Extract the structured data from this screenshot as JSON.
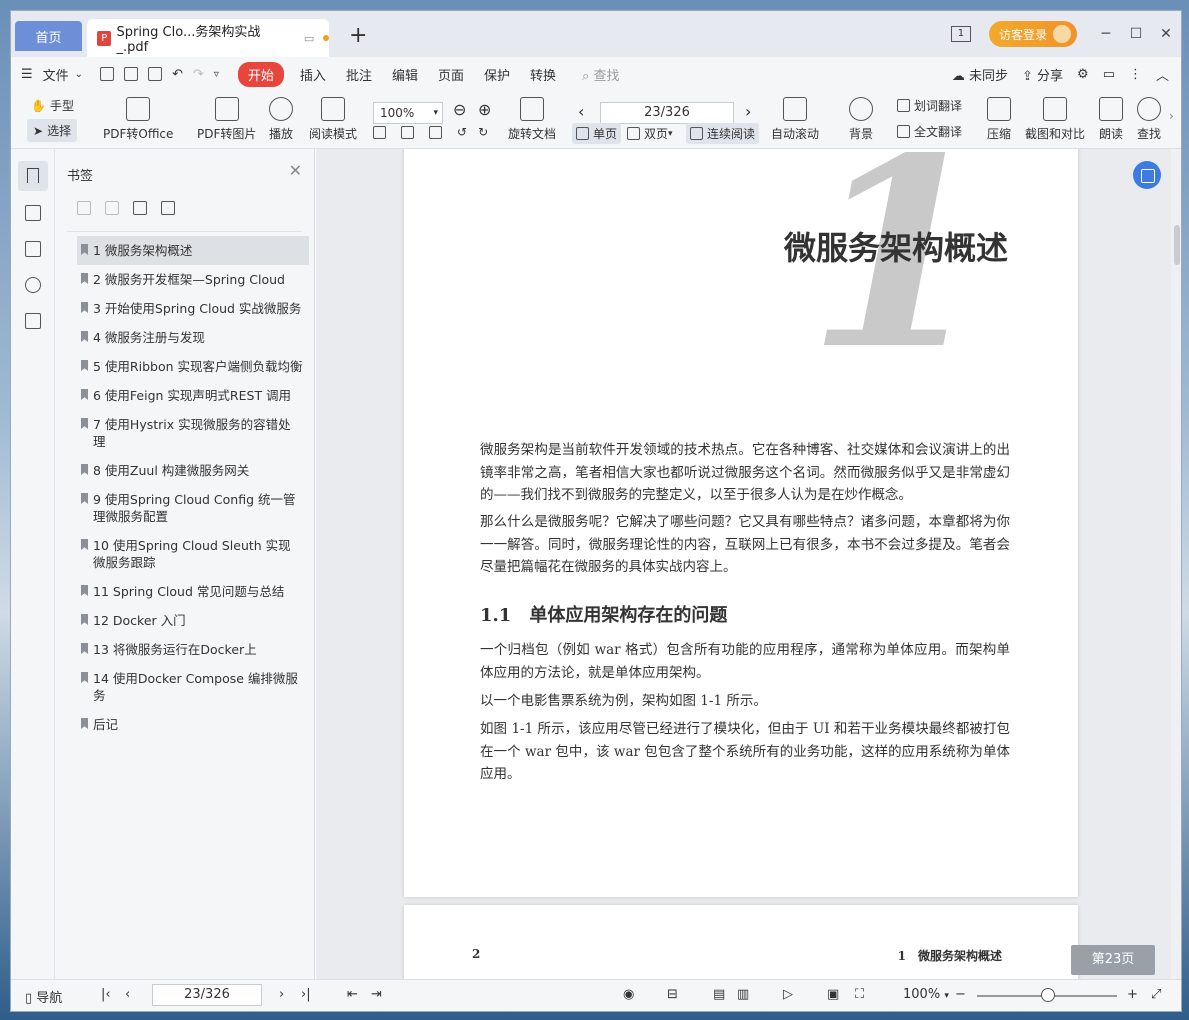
{
  "titlebar": {
    "home_tab": "首页",
    "doc_tab": "Spring Clo...务架构实战_.pdf",
    "add_tab": "+",
    "badge_num": "1",
    "guest_login": "访客登录"
  },
  "menubar": {
    "file": "文件",
    "start": "开始",
    "insert": "插入",
    "annotate": "批注",
    "edit": "编辑",
    "page": "页面",
    "protect": "保护",
    "convert": "转换",
    "search_placeholder": "查找",
    "unsynced": "未同步",
    "share": "分享"
  },
  "ribbon": {
    "hand": "手型",
    "select": "选择",
    "pdf_to_office": "PDF转Office",
    "pdf_to_image": "PDF转图片",
    "play": "播放",
    "read_mode": "阅读模式",
    "zoom": "100%",
    "rotate": "旋转文档",
    "page_value": "23/326",
    "single": "单页",
    "double": "双页",
    "continuous": "连续阅读",
    "auto_scroll": "自动滚动",
    "background": "背景",
    "word_translate": "划词翻译",
    "full_translate": "全文翻译",
    "compress": "压缩",
    "screenshot_compare": "截图和对比",
    "read_aloud": "朗读",
    "find": "查找"
  },
  "bookmarks": {
    "title": "书签",
    "items": [
      "1 微服务架构概述",
      "2 微服务开发框架—Spring Cloud",
      "3 开始使用Spring Cloud 实战微服务",
      "4 微服务注册与发现",
      "5 使用Ribbon 实现客户端侧负载均衡",
      "6 使用Feign 实现声明式REST 调用",
      "7 使用Hystrix 实现微服务的容错处理",
      "8 使用Zuul 构建微服务网关",
      "9 使用Spring Cloud Config 统一管理微服务配置",
      "10 使用Spring Cloud Sleuth 实现微服务跟踪",
      "11 Spring Cloud 常见问题与总结",
      "12 Docker 入门",
      "13 将微服务运行在Docker上",
      "14 使用Docker Compose 编排微服务",
      "后记"
    ]
  },
  "document": {
    "chapter_number": "1",
    "chapter_title": "微服务架构概述",
    "p1": "微服务架构是当前软件开发领域的技术热点。它在各种博客、社交媒体和会议演讲上的出镜率非常之高，笔者相信大家也都听说过微服务这个名词。然而微服务似乎又是非常虚幻的——我们找不到微服务的完整定义，以至于很多人认为是在炒作概念。",
    "p2": "那么什么是微服务呢？它解决了哪些问题？它又具有哪些特点？诸多问题，本章都将为你一一解答。同时，微服务理论性的内容，互联网上已有很多，本书不会过多提及。笔者会尽量把篇幅花在微服务的具体实战内容上。",
    "section": "1.1　单体应用架构存在的问题",
    "p3": "一个归档包（例如 war 格式）包含所有功能的应用程序，通常称为单体应用。而架构单体应用的方法论，就是单体应用架构。",
    "p4": "以一个电影售票系统为例，架构如图 1-1 所示。",
    "p5": "如图 1-1 所示，该应用尽管已经进行了模块化，但由于 UI 和若干业务模块最终都被打包在一个 war 包中，该 war 包包含了整个系统所有的业务功能，这样的应用系统称为单体应用。",
    "page2_num": "2",
    "page2_header": "1　微服务架构概述",
    "page_badge": "第23页"
  },
  "statusbar": {
    "nav": "导航",
    "page_value": "23/326",
    "zoom": "100%"
  }
}
